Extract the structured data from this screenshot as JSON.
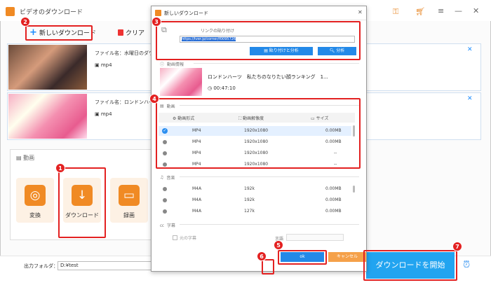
{
  "app": {
    "title": "ビデオのダウンロード",
    "accent": "#f08a24",
    "blue": "#22a4f0",
    "annotation_red": "#e32121"
  },
  "toolbar": {
    "new_download": "新しいダウンロード",
    "clear": "クリア"
  },
  "tasks": [
    {
      "file_label": "ファイル名：水曜日のダウンタ",
      "format": "mp4"
    },
    {
      "file_label": "ファイル名：ロンドンハーツ",
      "format": "mp4"
    }
  ],
  "format_panel": {
    "header": "動画",
    "tiles": [
      {
        "label": "変換",
        "icon": "film-icon"
      },
      {
        "label": "ダウンロード",
        "icon": "download-arrow-icon"
      },
      {
        "label": "録画",
        "icon": "monitor-icon"
      }
    ]
  },
  "bottom": {
    "output_label": "出力フォルダ：",
    "output_path": "D:¥test",
    "download_button": "ダウンロードを開始"
  },
  "dialog": {
    "title": "新しいダウンロード",
    "paste_label": "リンクの貼り付け",
    "url": "https://tver.jp/corner/f0095726",
    "paste_analyze": "貼り付けと分析",
    "analyze": "分析",
    "video_info": "動画情報",
    "video_title": "ロンドンハーツ　私たちのなりたい顔ランキング　1...",
    "duration": "00:47:10",
    "video_section": "動画",
    "video_columns": [
      "動画形式",
      "動画解像度",
      "サイズ"
    ],
    "video_rows": [
      {
        "format": "MP4",
        "resolution": "1920x1080",
        "size": "0.00MB",
        "selected": true
      },
      {
        "format": "MP4",
        "resolution": "1920x1080",
        "size": "0.00MB",
        "selected": false
      },
      {
        "format": "MP4",
        "resolution": "1920x1080",
        "size": "--",
        "selected": false
      },
      {
        "format": "MP4",
        "resolution": "1920x1080",
        "size": "--",
        "selected": false
      }
    ],
    "audio_section": "音楽",
    "audio_rows": [
      {
        "format": "M4A",
        "bitrate": "192k",
        "size": "0.00MB"
      },
      {
        "format": "M4A",
        "bitrate": "192k",
        "size": "0.00MB"
      },
      {
        "format": "M4A",
        "bitrate": "127k",
        "size": "0.00MB"
      }
    ],
    "subtitle_section": "字幕",
    "original_subtitle": "元の字幕",
    "language_label": "言語",
    "ok": "ok",
    "cancel": "キャンセル"
  },
  "badges": [
    "1",
    "2",
    "3",
    "4",
    "5",
    "6",
    "7"
  ]
}
